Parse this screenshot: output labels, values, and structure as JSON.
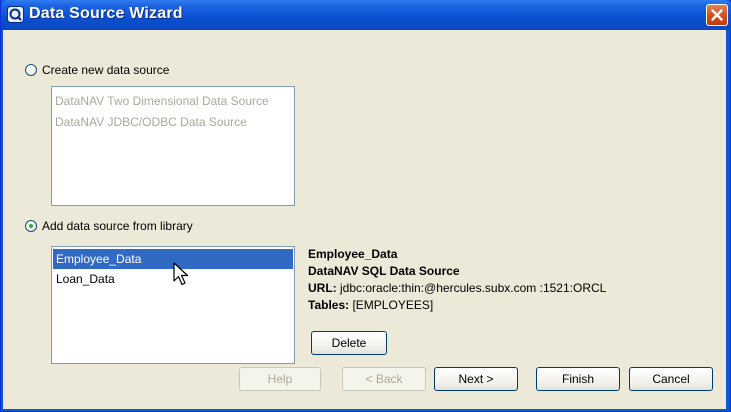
{
  "window": {
    "title": "Data Source Wizard",
    "app_icon": "datanav-app-icon",
    "close_icon": "close-icon"
  },
  "create_new": {
    "radio_label": "Create new data source",
    "checked": false,
    "options": [
      "DataNAV Two Dimensional Data Source",
      "DataNAV JDBC/ODBC Data Source"
    ]
  },
  "from_library": {
    "radio_label": "Add data source from library",
    "checked": true,
    "items": [
      "Employee_Data",
      "Loan_Data"
    ],
    "selected": "Employee_Data"
  },
  "details": {
    "name": "Employee_Data",
    "type": "DataNAV SQL Data Source",
    "url_label": "URL:",
    "url_value": "jdbc:oracle:thin:@hercules.subx.com :1521:ORCL",
    "tables_label": "Tables:",
    "tables_value": "[EMPLOYEES]"
  },
  "buttons": {
    "delete": "Delete",
    "help": "Help",
    "back": "< Back",
    "next": "Next >",
    "finish": "Finish",
    "cancel": "Cancel"
  }
}
